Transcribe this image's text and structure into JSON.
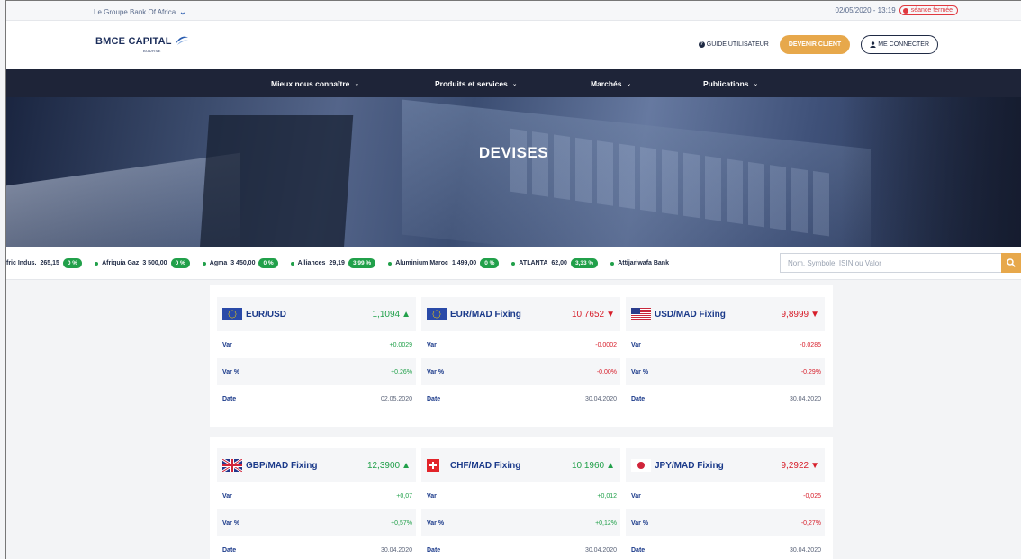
{
  "topbar": {
    "group_label": "Le Groupe Bank Of Africa",
    "datetime": "02/05/2020 - 13:19",
    "market_status": "séance fermée"
  },
  "header": {
    "logo_name": "BMCE CAPITAL",
    "logo_sub": "BOURSE",
    "guide_label": "GUIDE UTILISATEUR",
    "client_label": "DEVENIR CLIENT",
    "login_label": "ME CONNECTER"
  },
  "nav": {
    "items": [
      {
        "label": "Mieux nous connaître"
      },
      {
        "label": "Produits et services"
      },
      {
        "label": "Marchés"
      },
      {
        "label": "Publications"
      }
    ]
  },
  "hero": {
    "title": "DEVISES"
  },
  "ticker": {
    "items": [
      {
        "name": "fric Indus.",
        "price": "265,15",
        "pct": "0 %",
        "bullet": false
      },
      {
        "name": "Afriquia Gaz",
        "price": "3 500,00",
        "pct": "0 %",
        "bullet": true
      },
      {
        "name": "Agma",
        "price": "3 450,00",
        "pct": "0 %",
        "bullet": true
      },
      {
        "name": "Alliances",
        "price": "29,19",
        "pct": "3,99 %",
        "bullet": true
      },
      {
        "name": "Aluminium Maroc",
        "price": "1 499,00",
        "pct": "0 %",
        "bullet": true
      },
      {
        "name": "ATLANTA",
        "price": "62,00",
        "pct": "3,33 %",
        "bullet": true
      },
      {
        "name": "Attijariwafa Bank",
        "price": "",
        "pct": "",
        "bullet": true
      }
    ],
    "search_placeholder": "Nom, Symbole, ISIN ou Valor"
  },
  "labels": {
    "var": "Var",
    "var_pct": "Var %",
    "date": "Date"
  },
  "currencies": [
    {
      "pair": "EUR/USD",
      "value": "1,1094",
      "dir": "up",
      "flag": "eu",
      "var": "+0,0029",
      "var_pct": "+0,26%",
      "date": "02.05.2020"
    },
    {
      "pair": "EUR/MAD Fixing",
      "value": "10,7652",
      "dir": "down",
      "flag": "eu",
      "var": "-0,0002",
      "var_pct": "-0,00%",
      "date": "30.04.2020"
    },
    {
      "pair": "USD/MAD Fixing",
      "value": "9,8999",
      "dir": "down",
      "flag": "us",
      "var": "-0,0285",
      "var_pct": "-0,29%",
      "date": "30.04.2020"
    },
    {
      "pair": "GBP/MAD Fixing",
      "value": "12,3900",
      "dir": "up",
      "flag": "gb",
      "var": "+0,07",
      "var_pct": "+0,57%",
      "date": "30.04.2020"
    },
    {
      "pair": "CHF/MAD Fixing",
      "value": "10,1960",
      "dir": "up",
      "flag": "ch",
      "var": "+0,012",
      "var_pct": "+0,12%",
      "date": "30.04.2020"
    },
    {
      "pair": "JPY/MAD Fixing",
      "value": "9,2922",
      "dir": "down",
      "flag": "jp",
      "var": "-0,025",
      "var_pct": "-0,27%",
      "date": "30.04.2020"
    }
  ],
  "colors": {
    "accent": "#e7a84b",
    "nav_bg": "#1e2438",
    "up": "#21a04a",
    "down": "#d71e2a",
    "title_blue": "#1b3a8a"
  }
}
